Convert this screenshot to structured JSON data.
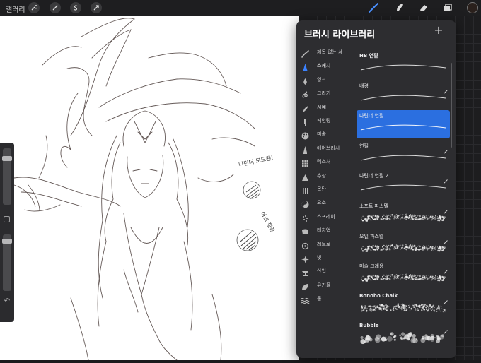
{
  "toolbar": {
    "gallery_label": "갤러리",
    "left_tools": [
      "wrench-icon",
      "magic-wand-icon",
      "selection-s-icon",
      "transform-arrow-icon"
    ],
    "right_tools": [
      "brush-icon",
      "smudge-icon",
      "eraser-icon",
      "layers-icon"
    ],
    "active_tool_color": "#4a90ff",
    "current_color": "#2a201c"
  },
  "sidebar": {
    "brush_size_level": 0.15,
    "opacity_level": 0.08
  },
  "canvas": {
    "annotation_1": "나린더 모드펜!",
    "annotation_2": "아크 질감"
  },
  "brush_library": {
    "title": "브러시 라이브러리",
    "add_icon": "plus-icon",
    "categories": [
      {
        "label": "제목 없는 세",
        "icon": "stroke-icon"
      },
      {
        "label": "스케치",
        "icon": "pencil-tip-icon",
        "active": true
      },
      {
        "label": "잉크",
        "icon": "ink-drop-icon"
      },
      {
        "label": "그리기",
        "icon": "drawing-swirl-icon"
      },
      {
        "label": "서예",
        "icon": "calligraphy-icon"
      },
      {
        "label": "페인팅",
        "icon": "paint-brush-icon"
      },
      {
        "label": "미술",
        "icon": "palette-icon"
      },
      {
        "label": "에어브러시",
        "icon": "airbrush-icon"
      },
      {
        "label": "텍스처",
        "icon": "texture-grid-icon"
      },
      {
        "label": "추상",
        "icon": "triangle-icon"
      },
      {
        "label": "목탄",
        "icon": "charcoal-icon"
      },
      {
        "label": "요소",
        "icon": "yin-yang-icon"
      },
      {
        "label": "스프레이",
        "icon": "spray-can-icon"
      },
      {
        "label": "터치업",
        "icon": "touchup-icon"
      },
      {
        "label": "레트로",
        "icon": "retro-star-icon"
      },
      {
        "label": "빛",
        "icon": "sparkle-icon"
      },
      {
        "label": "산업",
        "icon": "anvil-icon"
      },
      {
        "label": "유기물",
        "icon": "leaf-icon"
      },
      {
        "label": "물",
        "icon": "waves-icon"
      }
    ],
    "brushes": [
      {
        "name": "HB 연필",
        "style": "pencil"
      },
      {
        "name": "배경",
        "style": "pencil"
      },
      {
        "name": "나린더 연필",
        "style": "pencil",
        "selected": true
      },
      {
        "name": "연필",
        "style": "pencil"
      },
      {
        "name": "나린더 연필 2",
        "style": "pencil"
      },
      {
        "name": "소프트 파스텔",
        "style": "pastel"
      },
      {
        "name": "오일 파스텔",
        "style": "pastel"
      },
      {
        "name": "미술 크레용",
        "style": "crayon"
      },
      {
        "name": "Bonobo Chalk",
        "style": "chalk"
      },
      {
        "name": "Bubble",
        "style": "bubble"
      }
    ]
  }
}
